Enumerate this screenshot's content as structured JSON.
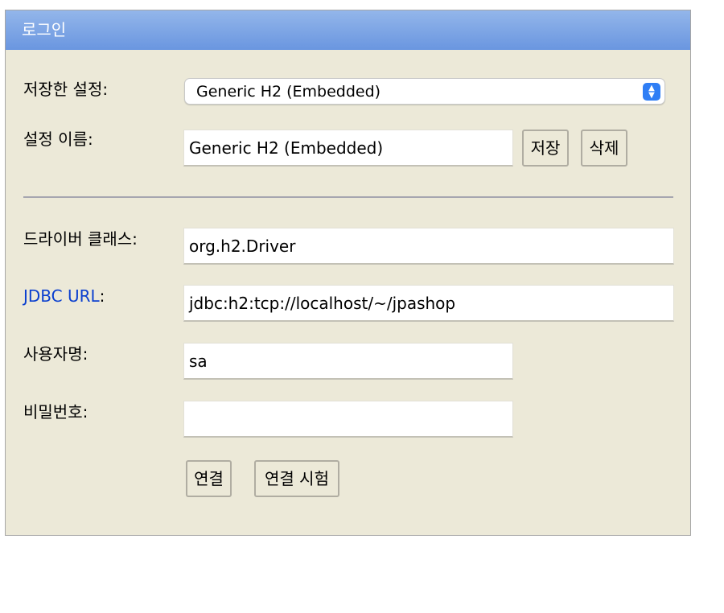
{
  "title": "로그인",
  "saved_settings": {
    "label": "저장한 설정:",
    "selected": "Generic H2 (Embedded)"
  },
  "setting_name": {
    "label": "설정 이름:",
    "value": "Generic H2 (Embedded)",
    "save_label": "저장",
    "delete_label": "삭제"
  },
  "driver_class": {
    "label": "드라이버 클래스:",
    "value": "org.h2.Driver"
  },
  "jdbc_url": {
    "link_text": "JDBC URL",
    "colon": ":",
    "value": "jdbc:h2:tcp://localhost/~/jpashop"
  },
  "username": {
    "label": "사용자명:",
    "value": "sa"
  },
  "password": {
    "label": "비밀번호:",
    "value": ""
  },
  "buttons": {
    "connect_label": "연결",
    "test_connection_label": "연결 시험"
  },
  "icons": {
    "select_arrows": "chevron-up-down-icon"
  },
  "colors": {
    "titlebar": "#6a96e0",
    "panel": "#ece9d8",
    "link": "#0a3fcf",
    "select_accent": "#2f7ef5"
  }
}
